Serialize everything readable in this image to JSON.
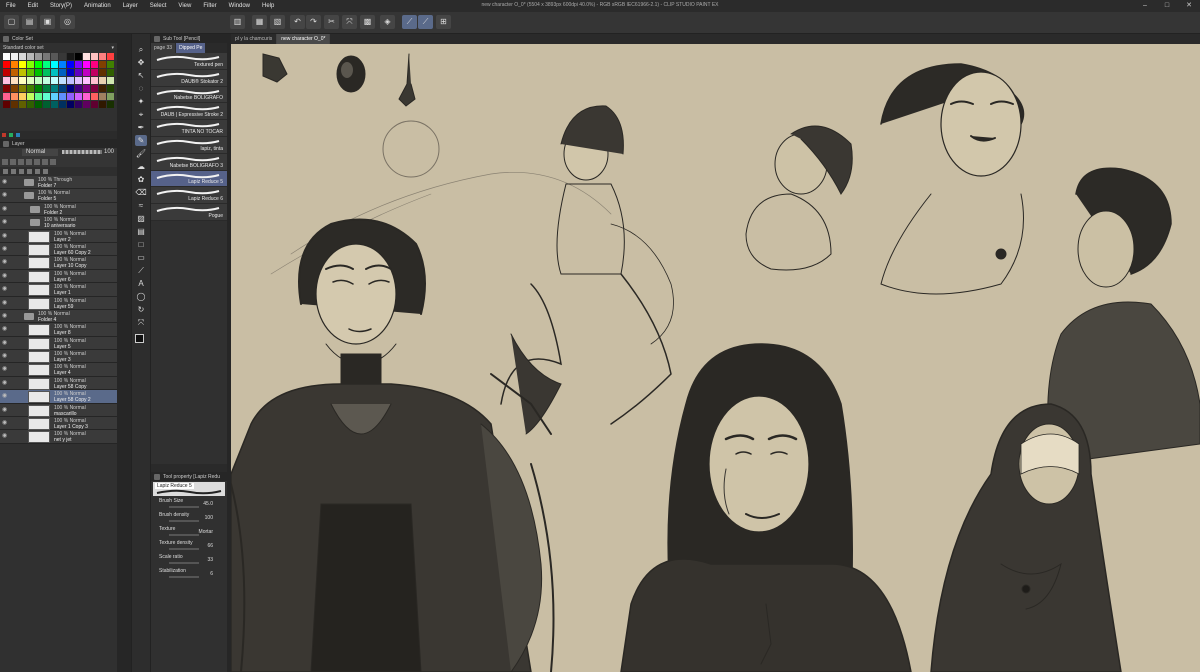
{
  "menu": [
    "File",
    "Edit",
    "Story(P)",
    "Animation",
    "Layer",
    "Select",
    "View",
    "Filter",
    "Window",
    "Help"
  ],
  "title": "new character O_0* (5504 x 3893px 600dpi 40.0%) - RGB sRGB IEC61966-2.1) - CLIP STUDIO PAINT EX",
  "color_panel": {
    "tabs": [
      "Color Set"
    ],
    "set_name": "Standard color set"
  },
  "layer_panel": {
    "title": "Layer",
    "blend": "Normal",
    "opacity": "100",
    "layers": [
      {
        "mode": "100 % Through",
        "name": "Folder 7",
        "type": "folder",
        "indent": 1
      },
      {
        "mode": "100 % Normal",
        "name": "Folder 5",
        "type": "folder",
        "indent": 1
      },
      {
        "mode": "100 % Normal",
        "name": "Folder 2",
        "type": "folder",
        "indent": 2
      },
      {
        "mode": "100 % Normal",
        "name": "10 aniversario",
        "type": "folder",
        "indent": 2
      },
      {
        "mode": "100 % Normal",
        "name": "Layer 2",
        "type": "layer"
      },
      {
        "mode": "100 % Normal",
        "name": "Layer 60 Copy 2",
        "type": "layer"
      },
      {
        "mode": "100 % Normal",
        "name": "Layer 10 Copy",
        "type": "layer"
      },
      {
        "mode": "100 % Normal",
        "name": "Layer 6",
        "type": "layer"
      },
      {
        "mode": "100 % Normal",
        "name": "Layer 1",
        "type": "layer"
      },
      {
        "mode": "100 % Normal",
        "name": "Layer 59",
        "type": "layer"
      },
      {
        "mode": "100 % Normal",
        "name": "Folder 4",
        "type": "folder",
        "indent": 1
      },
      {
        "mode": "100 % Normal",
        "name": "Layer 8",
        "type": "layer"
      },
      {
        "mode": "100 % Normal",
        "name": "Layer 5",
        "type": "layer"
      },
      {
        "mode": "100 % Normal",
        "name": "Layer 3",
        "type": "layer"
      },
      {
        "mode": "100 % Normal",
        "name": "Layer 4",
        "type": "layer"
      },
      {
        "mode": "100 % Normal",
        "name": "Layer 58 Copy",
        "type": "layer"
      },
      {
        "mode": "100 % Normal",
        "name": "Layer 58 Copy 2",
        "type": "layer",
        "selected": true
      },
      {
        "mode": "100 % Normal",
        "name": "mascarillo",
        "type": "layer"
      },
      {
        "mode": "100 % Normal",
        "name": "Layer 1 Copy 3",
        "type": "layer"
      },
      {
        "mode": "100 % Normal",
        "name": "net y jet",
        "type": "layer"
      }
    ]
  },
  "subtool": {
    "title": "Sub Tool [Pencil]",
    "tabs": [
      "page 33",
      "Dipped Pe"
    ],
    "brushes": [
      "Textured pen",
      "DAUB® Stokator 2",
      "Nabetse BOLIGRAFO",
      "DAUB | Expressive Stroke 2",
      "TINTA NO TOCAR",
      "lapiz, tinta",
      "Nabetse BOLIGRAFO 3",
      "Lapiz Reduce 5",
      "Lapiz Reduce 6",
      "Pogue"
    ],
    "selected_index": 7
  },
  "tool_property": {
    "title": "Tool property [Lapiz Redu",
    "brush_name": "Lapiz Reduce 5",
    "props": [
      {
        "label": "Brush Size",
        "value": "45.0"
      },
      {
        "label": "Brush density",
        "value": "100"
      },
      {
        "label": "Texture",
        "value": "Mortar"
      },
      {
        "label": "Texture density",
        "value": "66"
      },
      {
        "label": "Scale ratio",
        "value": "33"
      },
      {
        "label": "Stabilization",
        "value": "6"
      }
    ]
  },
  "doc_tabs": [
    "pl y la chamcuris",
    "new character O_0*"
  ],
  "toolbar_icons": [
    "new-icon",
    "open-icon",
    "save-icon",
    "undo-icon",
    "redo-icon",
    "clear-icon",
    "transform-icon",
    "fill-icon",
    "snap-icon",
    "ruler-icon",
    "perspective-icon",
    "grid-icon"
  ]
}
